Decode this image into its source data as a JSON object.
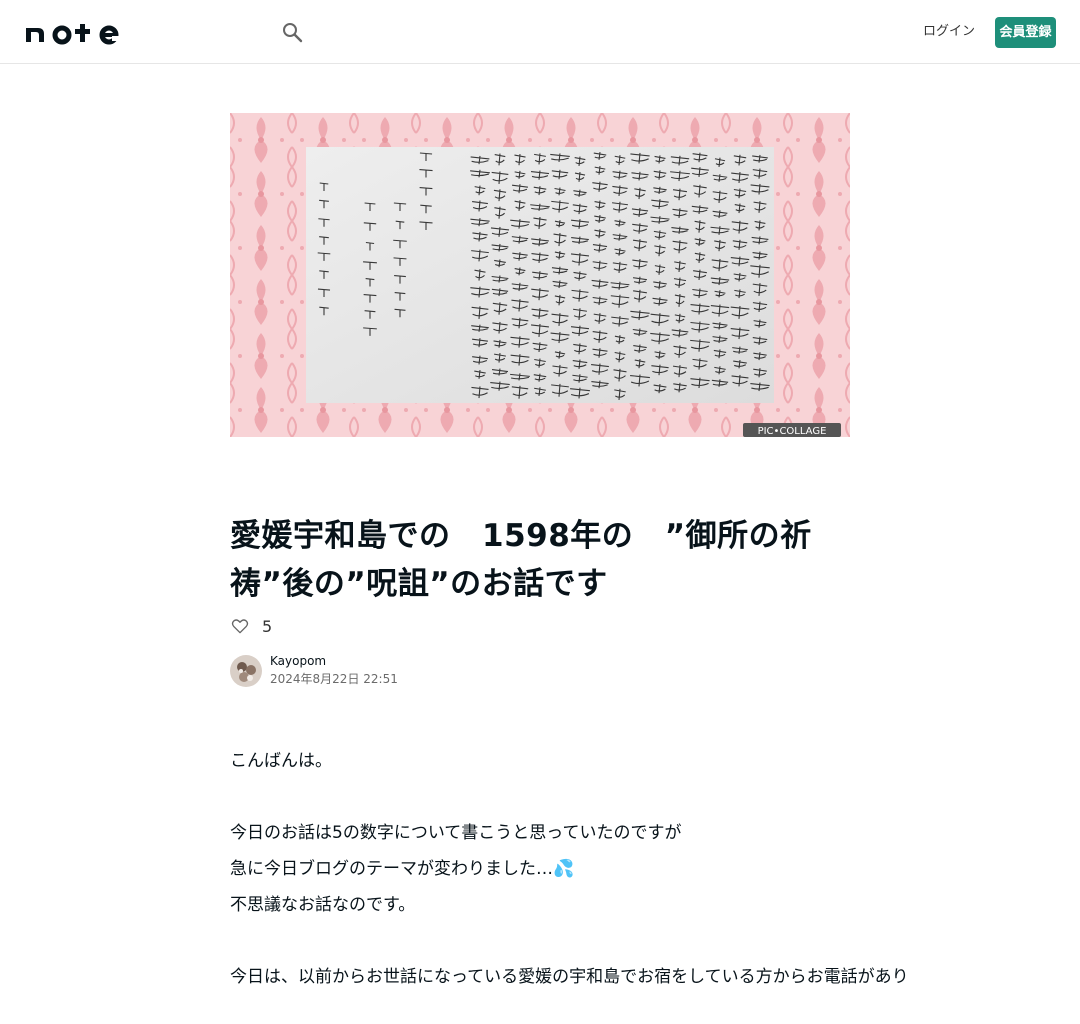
{
  "header": {
    "logo_text": "note",
    "search_icon": "search-icon",
    "login_label": "ログイン",
    "signup_label": "会員登録",
    "accent_color": "#1e8f7a"
  },
  "hero": {
    "alt_icon": "calligraphy-image",
    "badge": "PIC•COLLAGE"
  },
  "article": {
    "title": "愛媛宇和島での　1598年の　”御所の祈祷”後の”呪詛”のお話です",
    "like_count": "5",
    "author": {
      "name": "Kayopom",
      "date": "2024年8月22日 22:51"
    },
    "paragraphs": [
      "こんばんは。",
      "",
      "今日のお話は5の数字について書こうと思っていたのですが",
      "急に今日ブログのテーマが変わりました…💦",
      "不思議なお話なのです。",
      "",
      "今日は、以前からお世話になっている愛媛の宇和島でお宿をしている方からお電話があり"
    ]
  }
}
